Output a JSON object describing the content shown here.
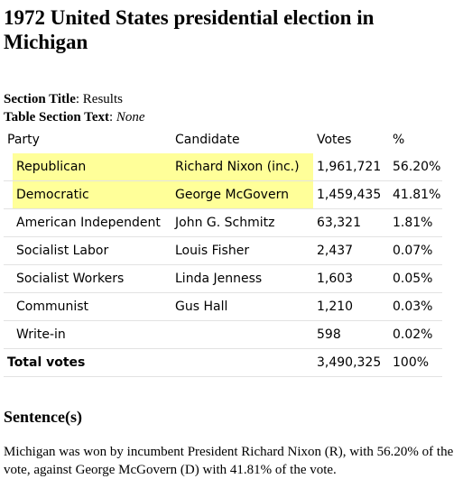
{
  "page": {
    "title": "1972 United States presidential election in Michigan",
    "section_title_label": "Section Title",
    "section_title_value": "Results",
    "table_section_label": "Table Section Text",
    "table_section_value": "None"
  },
  "table": {
    "headers": [
      "Party",
      "Candidate",
      "Votes",
      "%"
    ],
    "rows": [
      {
        "party": "Republican",
        "candidate": "Richard Nixon (inc.)",
        "votes": "1,961,721",
        "pct": "56.20%",
        "highlight": true
      },
      {
        "party": "Democratic",
        "candidate": "George McGovern",
        "votes": "1,459,435",
        "pct": "41.81%",
        "highlight": true
      },
      {
        "party": "American Independent",
        "candidate": "John G. Schmitz",
        "votes": "63,321",
        "pct": "1.81%",
        "highlight": false
      },
      {
        "party": "Socialist Labor",
        "candidate": "Louis Fisher",
        "votes": "2,437",
        "pct": "0.07%",
        "highlight": false
      },
      {
        "party": "Socialist Workers",
        "candidate": "Linda Jenness",
        "votes": "1,603",
        "pct": "0.05%",
        "highlight": false
      },
      {
        "party": "Communist",
        "candidate": "Gus Hall",
        "votes": "1,210",
        "pct": "0.03%",
        "highlight": false
      },
      {
        "party": "Write-in",
        "candidate": "",
        "votes": "598",
        "pct": "0.02%",
        "highlight": false
      }
    ],
    "total": {
      "label": "Total votes",
      "votes": "3,490,325",
      "pct": "100%"
    }
  },
  "sentences": {
    "heading": "Sentence(s)",
    "text": "Michigan was won by incumbent President Richard Nixon (R), with 56.20% of the vote, against George McGovern (D) with 41.81% of the vote."
  },
  "colors": {
    "highlight": "#ffff99",
    "row_border": "#e2e2e2"
  }
}
